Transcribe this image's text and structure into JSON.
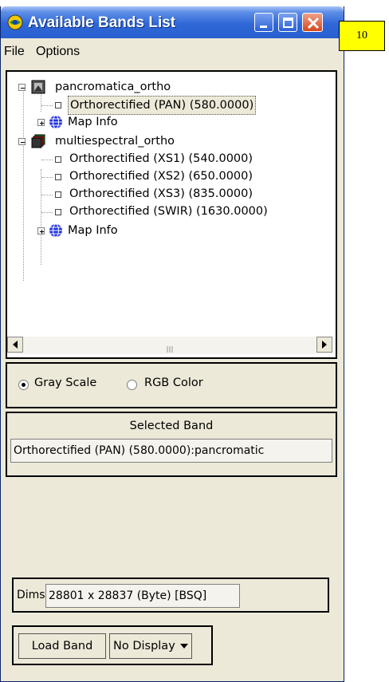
{
  "window": {
    "title": "Available Bands List"
  },
  "badge": {
    "number": "10"
  },
  "menu": {
    "file": "File",
    "options": "Options"
  },
  "tree": {
    "files": [
      {
        "name": "pancromatica_ortho",
        "bands": [
          "Orthorectified (PAN) (580.0000)"
        ],
        "map_info": "Map Info"
      },
      {
        "name": "multiespectral_ortho",
        "bands": [
          "Orthorectified (XS1) (540.0000)",
          "Orthorectified (XS2) (650.0000)",
          "Orthorectified (XS3) (835.0000)",
          "Orthorectified (SWIR) (1630.0000)"
        ],
        "map_info": "Map Info"
      }
    ]
  },
  "color_mode": {
    "gray_scale": "Gray Scale",
    "rgb_color": "RGB Color",
    "selected": "gray_scale"
  },
  "selected_band": {
    "label": "Selected Band",
    "value": "Orthorectified (PAN) (580.0000):pancromatic"
  },
  "dims": {
    "label": "Dims",
    "value": "28801 x 28837 (Byte) [BSQ]"
  },
  "actions": {
    "load_band": "Load Band",
    "display_select": "No Display"
  }
}
